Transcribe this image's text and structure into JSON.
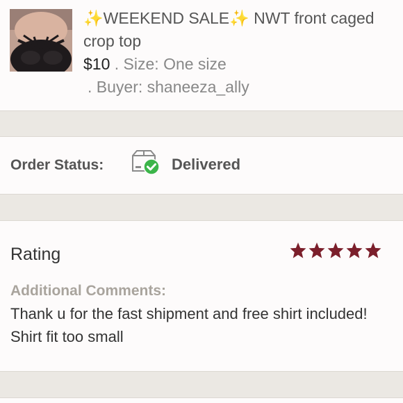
{
  "listing": {
    "sparkle_left": "✨",
    "title_part1": "WEEKEND SALE",
    "sparkle_right": "✨",
    "title_part2": " NWT front caged crop top",
    "price": "$10",
    "size_text": " . Size: One size",
    "buyer_text": ". Buyer: shaneeza_ally"
  },
  "order_status": {
    "label": "Order Status:",
    "icon": "delivered-box-icon",
    "value": "Delivered"
  },
  "rating": {
    "label": "Rating",
    "stars": 5,
    "star_color": "#7b1f2b",
    "comments_label": "Additional Comments:",
    "comments_text": "Thank u for the fast shipment and free shirt included! Shirt fit too small"
  },
  "colors": {
    "background": "#ebe8e3",
    "card": "#fdfbfb",
    "check_green": "#3cb54a"
  }
}
